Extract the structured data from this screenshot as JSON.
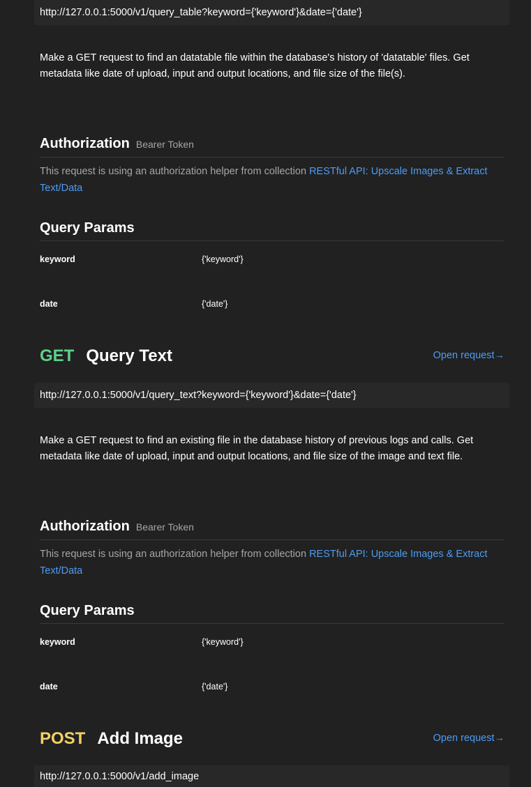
{
  "sections": [
    {
      "url": "http://127.0.0.1:5000/v1/query_table?keyword={'keyword'}&date={'date'}",
      "description": "Make a GET request to find an datatable file within the database's history of 'datatable' files. Get metadata like date of upload, input and output locations, and file size of the file(s).",
      "auth_title": "Authorization",
      "auth_type": "Bearer Token",
      "auth_note": "This request is using an authorization helper from collection ",
      "auth_link": "RESTful API: Upscale Images & Extract Text/Data",
      "params_title": "Query Params",
      "params": [
        {
          "key": "keyword",
          "value": "{'keyword'}"
        },
        {
          "key": "date",
          "value": "{'date'}"
        }
      ]
    },
    {
      "method": "GET",
      "name": "Query Text",
      "open_label": "Open request→",
      "url": "http://127.0.0.1:5000/v1/query_text?keyword={'keyword'}&date={'date'}",
      "description": "Make a GET request to find an existing file in the database history of previous logs and calls. Get metadata like date of upload, input and output locations, and file size of the image and text file.",
      "auth_title": "Authorization",
      "auth_type": "Bearer Token",
      "auth_note": "This request is using an authorization helper from collection ",
      "auth_link": "RESTful API: Upscale Images & Extract Text/Data",
      "params_title": "Query Params",
      "params": [
        {
          "key": "keyword",
          "value": "{'keyword'}"
        },
        {
          "key": "date",
          "value": "{'date'}"
        }
      ]
    },
    {
      "method": "POST",
      "name": "Add Image",
      "open_label": "Open request→",
      "url": "http://127.0.0.1:5000/v1/add_image"
    }
  ],
  "colors": {
    "background": "#212121",
    "url_bar": "#282828",
    "get": "#5ed18b",
    "post": "#f2d265",
    "link": "#4d9cf5",
    "muted": "#a6a6a6"
  }
}
